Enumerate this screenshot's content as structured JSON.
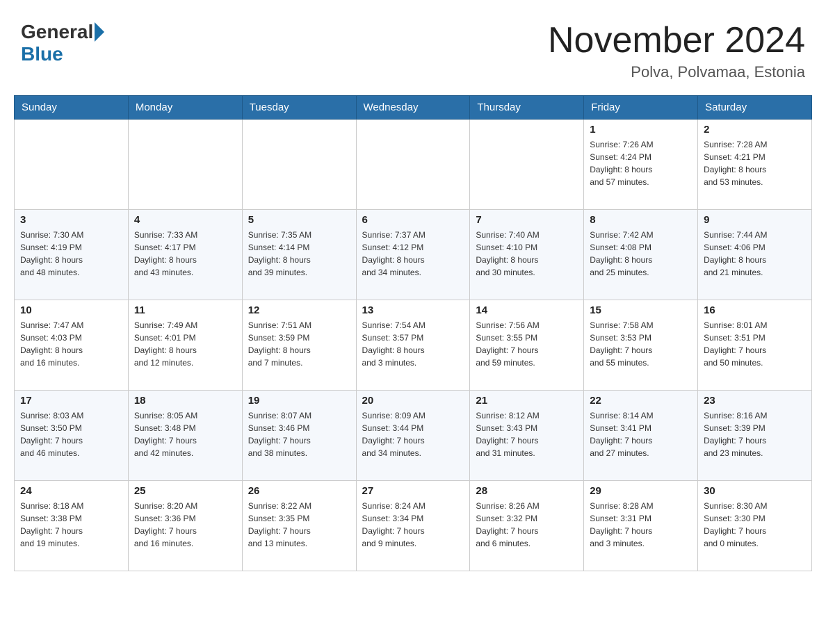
{
  "header": {
    "logo_general": "General",
    "logo_blue": "Blue",
    "title": "November 2024",
    "subtitle": "Polva, Polvamaa, Estonia"
  },
  "weekdays": [
    "Sunday",
    "Monday",
    "Tuesday",
    "Wednesday",
    "Thursday",
    "Friday",
    "Saturday"
  ],
  "weeks": [
    [
      {
        "day": "",
        "info": ""
      },
      {
        "day": "",
        "info": ""
      },
      {
        "day": "",
        "info": ""
      },
      {
        "day": "",
        "info": ""
      },
      {
        "day": "",
        "info": ""
      },
      {
        "day": "1",
        "info": "Sunrise: 7:26 AM\nSunset: 4:24 PM\nDaylight: 8 hours\nand 57 minutes."
      },
      {
        "day": "2",
        "info": "Sunrise: 7:28 AM\nSunset: 4:21 PM\nDaylight: 8 hours\nand 53 minutes."
      }
    ],
    [
      {
        "day": "3",
        "info": "Sunrise: 7:30 AM\nSunset: 4:19 PM\nDaylight: 8 hours\nand 48 minutes."
      },
      {
        "day": "4",
        "info": "Sunrise: 7:33 AM\nSunset: 4:17 PM\nDaylight: 8 hours\nand 43 minutes."
      },
      {
        "day": "5",
        "info": "Sunrise: 7:35 AM\nSunset: 4:14 PM\nDaylight: 8 hours\nand 39 minutes."
      },
      {
        "day": "6",
        "info": "Sunrise: 7:37 AM\nSunset: 4:12 PM\nDaylight: 8 hours\nand 34 minutes."
      },
      {
        "day": "7",
        "info": "Sunrise: 7:40 AM\nSunset: 4:10 PM\nDaylight: 8 hours\nand 30 minutes."
      },
      {
        "day": "8",
        "info": "Sunrise: 7:42 AM\nSunset: 4:08 PM\nDaylight: 8 hours\nand 25 minutes."
      },
      {
        "day": "9",
        "info": "Sunrise: 7:44 AM\nSunset: 4:06 PM\nDaylight: 8 hours\nand 21 minutes."
      }
    ],
    [
      {
        "day": "10",
        "info": "Sunrise: 7:47 AM\nSunset: 4:03 PM\nDaylight: 8 hours\nand 16 minutes."
      },
      {
        "day": "11",
        "info": "Sunrise: 7:49 AM\nSunset: 4:01 PM\nDaylight: 8 hours\nand 12 minutes."
      },
      {
        "day": "12",
        "info": "Sunrise: 7:51 AM\nSunset: 3:59 PM\nDaylight: 8 hours\nand 7 minutes."
      },
      {
        "day": "13",
        "info": "Sunrise: 7:54 AM\nSunset: 3:57 PM\nDaylight: 8 hours\nand 3 minutes."
      },
      {
        "day": "14",
        "info": "Sunrise: 7:56 AM\nSunset: 3:55 PM\nDaylight: 7 hours\nand 59 minutes."
      },
      {
        "day": "15",
        "info": "Sunrise: 7:58 AM\nSunset: 3:53 PM\nDaylight: 7 hours\nand 55 minutes."
      },
      {
        "day": "16",
        "info": "Sunrise: 8:01 AM\nSunset: 3:51 PM\nDaylight: 7 hours\nand 50 minutes."
      }
    ],
    [
      {
        "day": "17",
        "info": "Sunrise: 8:03 AM\nSunset: 3:50 PM\nDaylight: 7 hours\nand 46 minutes."
      },
      {
        "day": "18",
        "info": "Sunrise: 8:05 AM\nSunset: 3:48 PM\nDaylight: 7 hours\nand 42 minutes."
      },
      {
        "day": "19",
        "info": "Sunrise: 8:07 AM\nSunset: 3:46 PM\nDaylight: 7 hours\nand 38 minutes."
      },
      {
        "day": "20",
        "info": "Sunrise: 8:09 AM\nSunset: 3:44 PM\nDaylight: 7 hours\nand 34 minutes."
      },
      {
        "day": "21",
        "info": "Sunrise: 8:12 AM\nSunset: 3:43 PM\nDaylight: 7 hours\nand 31 minutes."
      },
      {
        "day": "22",
        "info": "Sunrise: 8:14 AM\nSunset: 3:41 PM\nDaylight: 7 hours\nand 27 minutes."
      },
      {
        "day": "23",
        "info": "Sunrise: 8:16 AM\nSunset: 3:39 PM\nDaylight: 7 hours\nand 23 minutes."
      }
    ],
    [
      {
        "day": "24",
        "info": "Sunrise: 8:18 AM\nSunset: 3:38 PM\nDaylight: 7 hours\nand 19 minutes."
      },
      {
        "day": "25",
        "info": "Sunrise: 8:20 AM\nSunset: 3:36 PM\nDaylight: 7 hours\nand 16 minutes."
      },
      {
        "day": "26",
        "info": "Sunrise: 8:22 AM\nSunset: 3:35 PM\nDaylight: 7 hours\nand 13 minutes."
      },
      {
        "day": "27",
        "info": "Sunrise: 8:24 AM\nSunset: 3:34 PM\nDaylight: 7 hours\nand 9 minutes."
      },
      {
        "day": "28",
        "info": "Sunrise: 8:26 AM\nSunset: 3:32 PM\nDaylight: 7 hours\nand 6 minutes."
      },
      {
        "day": "29",
        "info": "Sunrise: 8:28 AM\nSunset: 3:31 PM\nDaylight: 7 hours\nand 3 minutes."
      },
      {
        "day": "30",
        "info": "Sunrise: 8:30 AM\nSunset: 3:30 PM\nDaylight: 7 hours\nand 0 minutes."
      }
    ]
  ]
}
